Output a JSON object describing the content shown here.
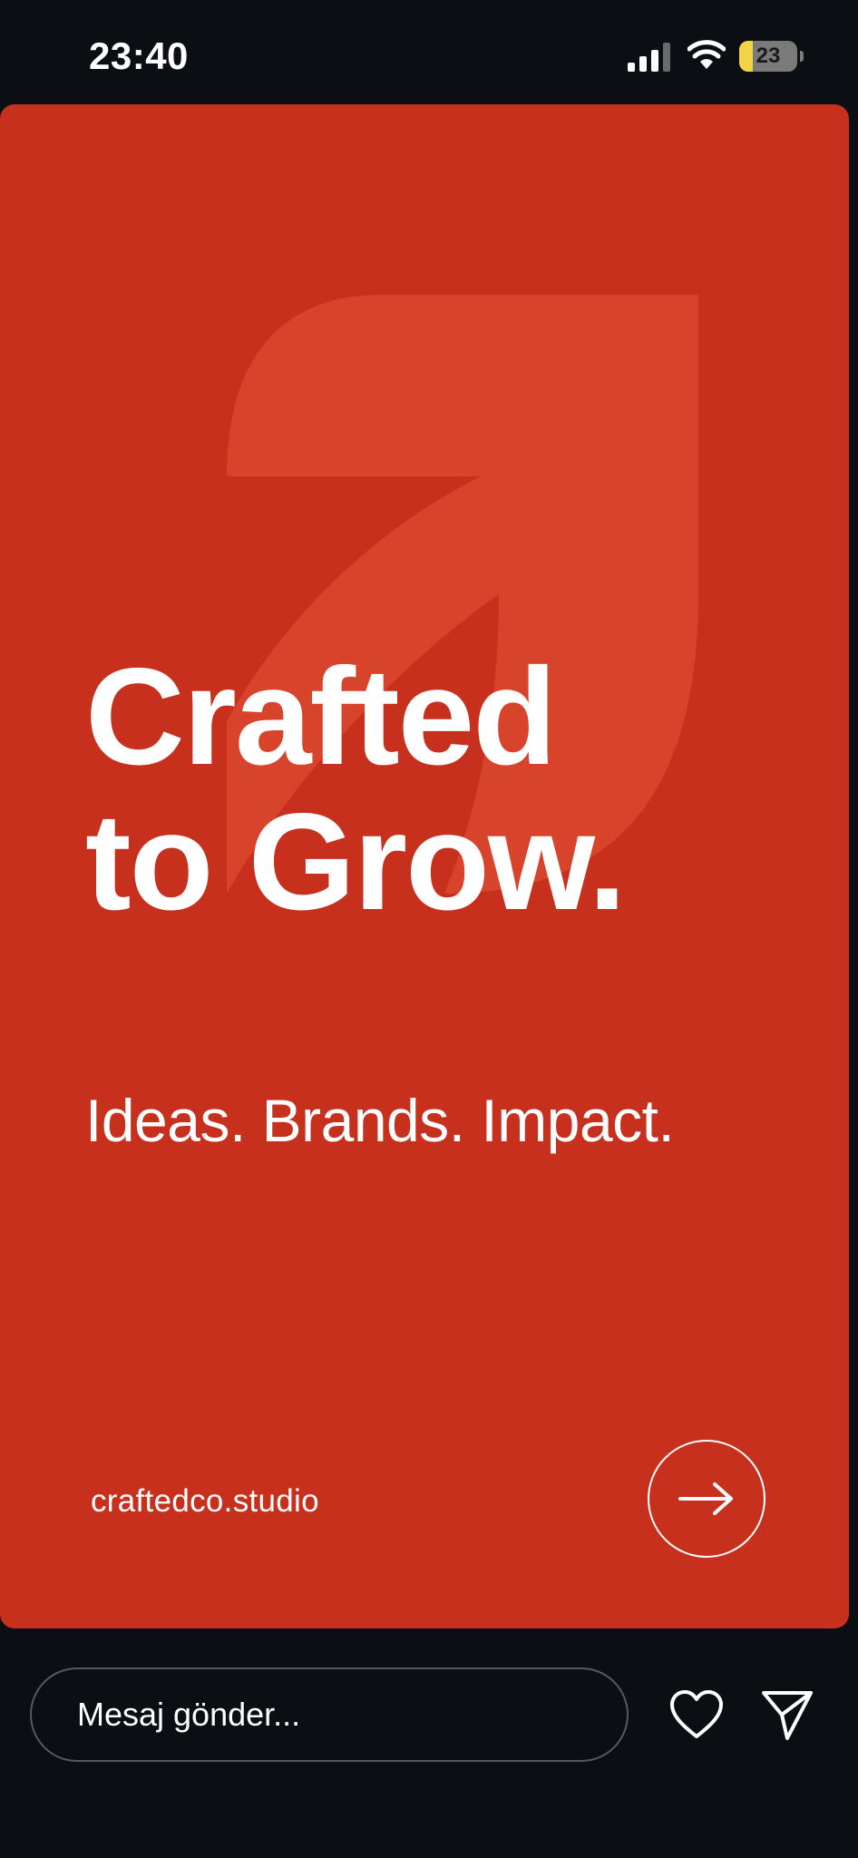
{
  "status_bar": {
    "time": "23:40",
    "battery_level": "23",
    "battery_fraction": 0.23,
    "icons": [
      "cellular-signal-icon",
      "wifi-icon",
      "battery-icon"
    ]
  },
  "story": {
    "background_color": "#c8301e",
    "logo": "leaf-arrow-logo",
    "headline_line1": "Crafted",
    "headline_line2": "to Grow.",
    "tagline": "Ideas. Brands. Impact.",
    "website": "craftedco.studio",
    "next_icon": "arrow-right-icon"
  },
  "reply_bar": {
    "placeholder": "Mesaj gönder...",
    "like_icon": "heart-icon",
    "send_icon": "send-icon"
  }
}
